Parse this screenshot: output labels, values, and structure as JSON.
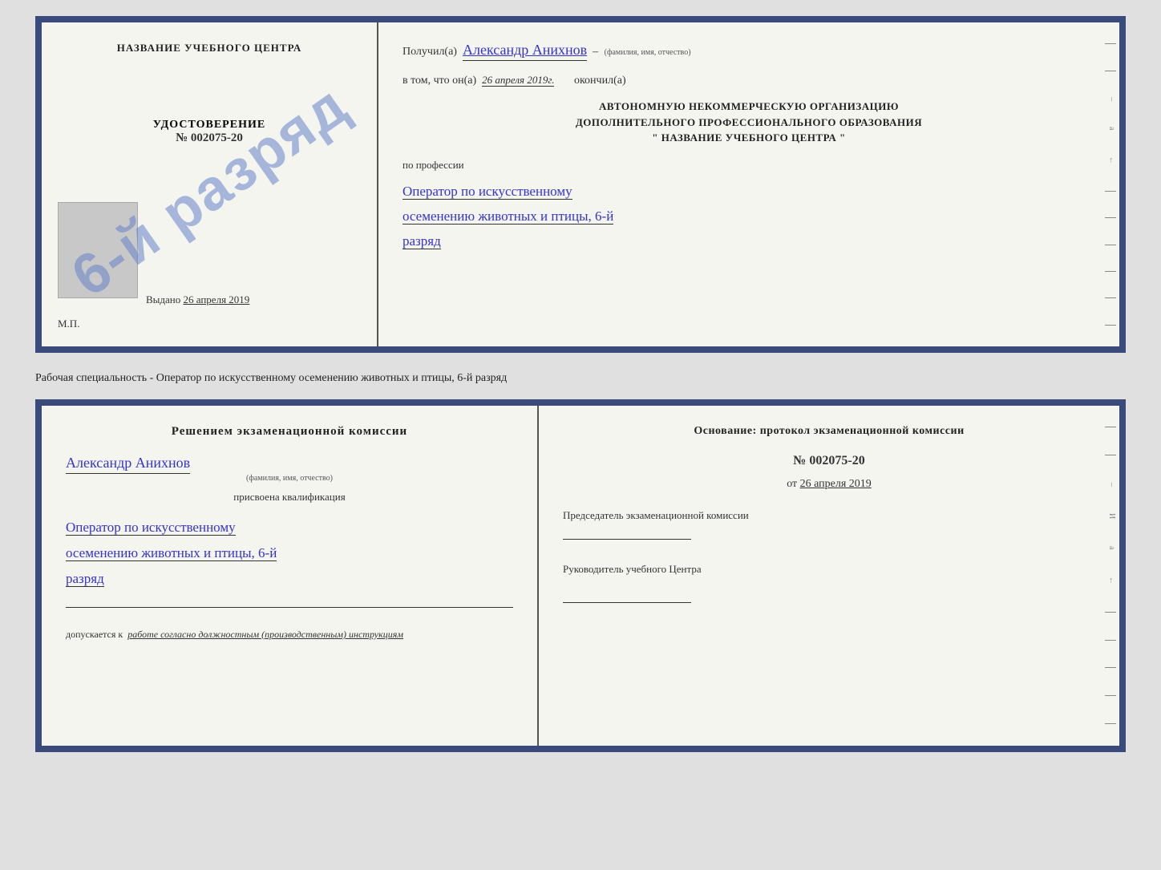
{
  "cert_top": {
    "left": {
      "school_name": "НАЗВАНИЕ УЧЕБНОГО ЦЕНТРА",
      "udostoverenie_label": "УДОСТОВЕРЕНИЕ",
      "number": "№ 002075-20",
      "stamp_text": "6-й разряд",
      "vydano_label": "Выдано",
      "vydano_date": "26 апреля 2019",
      "mp_label": "М.П."
    },
    "right": {
      "poluchil_label": "Получил(a)",
      "poluchil_name": "Александр Анихнов",
      "poluchil_subtitle": "(фамилия, имя, отчество)",
      "vtom_label": "в том, что он(а)",
      "vtom_date": "26 апреля 2019г.",
      "okonchil_label": "окончил(а)",
      "org_line1": "АВТОНОМНУЮ НЕКОММЕРЧЕСКУЮ ОРГАНИЗАЦИЮ",
      "org_line2": "ДОПОЛНИТЕЛЬНОГО ПРОФЕССИОНАЛЬНОГО ОБРАЗОВАНИЯ",
      "org_line3": "\"   НАЗВАНИЕ УЧЕБНОГО ЦЕНТРА   \"",
      "po_professii": "по профессии",
      "profession": "Оператор по искусственному осеменению животных и птицы, 6-й разряд"
    }
  },
  "separator": {
    "text": "Рабочая специальность - Оператор по искусственному осеменению животных и птицы, 6-й разряд"
  },
  "cert_bottom": {
    "left": {
      "reshenie_title": "Решением экзаменационной комиссии",
      "name": "Александр Анихнов",
      "name_subtitle": "(фамилия, имя, отчество)",
      "prisvoena": "присвоена квалификация",
      "qualification": "Оператор по искусственному осеменению животных и птицы, 6-й разряд",
      "dopuskaetsya_label": "допускается к",
      "dopuskaetsya_value": "работе согласно должностным (производственным) инструкциям"
    },
    "right": {
      "osnovanie_title": "Основание: протокол экзаменационной комиссии",
      "protocol_number": "№  002075-20",
      "protocol_date_prefix": "от",
      "protocol_date": "26 апреля 2019",
      "predsedatel_title": "Председатель экзаменационной комиссии",
      "rukovoditel_title": "Руководитель учебного Центра"
    }
  }
}
